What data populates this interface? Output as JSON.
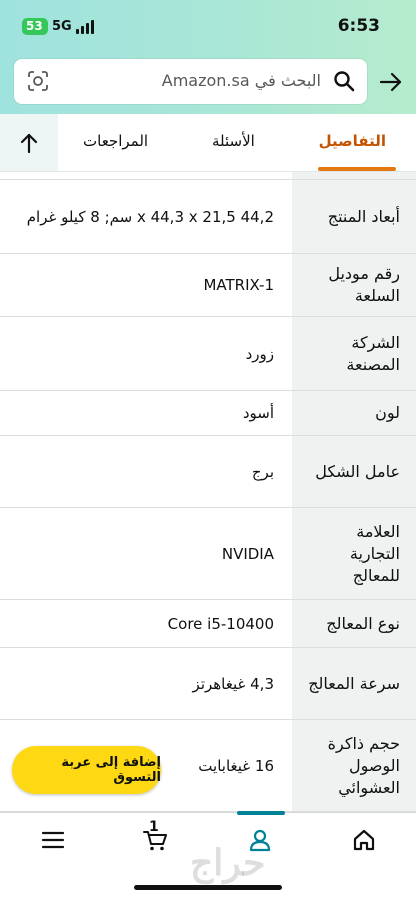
{
  "status_bar": {
    "battery": "53",
    "network": "5G",
    "time": "6:53"
  },
  "search": {
    "placeholder": "البحث في Amazon.sa"
  },
  "tabs": [
    {
      "label": "التفاصيل",
      "active": true
    },
    {
      "label": "الأسئلة",
      "active": false
    },
    {
      "label": "المراجعات",
      "active": false
    }
  ],
  "details": [
    {
      "key": "أبعاد المنتج",
      "value": "44,2 x 44,3 x 21,5 سم; 8 كيلو غرام"
    },
    {
      "key": "رقم موديل السلعة",
      "value": "MATRIX-1"
    },
    {
      "key": "الشركة المصنعة",
      "value": "زورد"
    },
    {
      "key": "لون",
      "value": "أسود"
    },
    {
      "key": "عامل الشكل",
      "value": "برج"
    },
    {
      "key": "العلامة التجارية للمعالج",
      "value": "NVIDIA"
    },
    {
      "key": "نوع المعالج",
      "value": "Core i5-10400"
    },
    {
      "key": "سرعة المعالج",
      "value": "4,3 غيغاهرتز"
    },
    {
      "key": "حجم ذاكرة الوصول العشوائي",
      "value": "16 غيغابايت"
    }
  ],
  "cta": {
    "label": "إضافة إلى عربة التسوق"
  },
  "bottom_nav": {
    "cart_count": "1",
    "watermark": "حراج"
  },
  "colors": {
    "accent": "#e47911",
    "cta": "#ffd814",
    "nav_active": "#008296"
  }
}
